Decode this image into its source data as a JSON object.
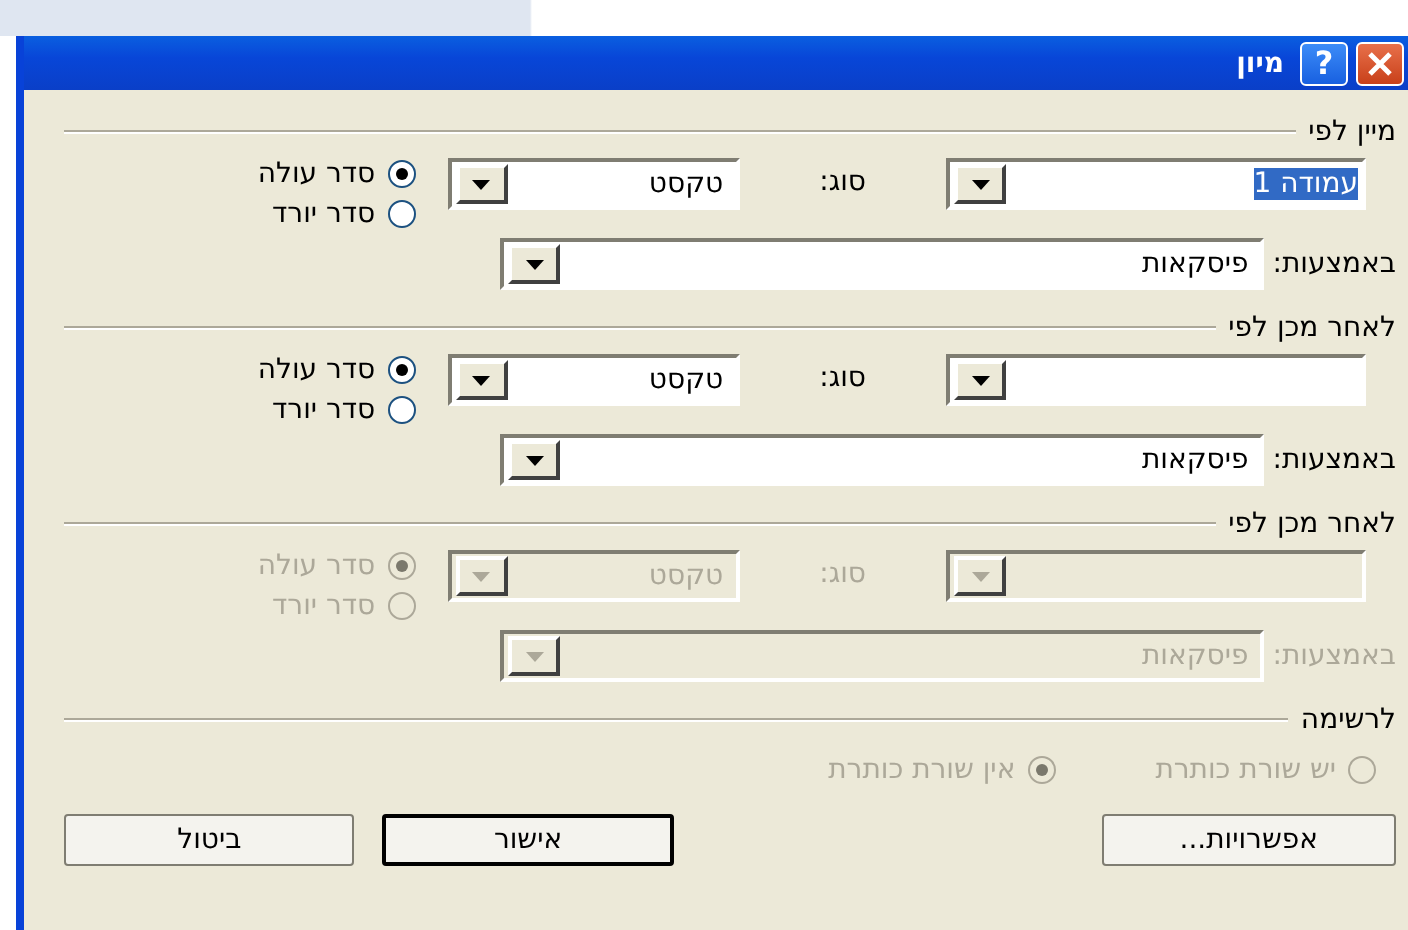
{
  "window": {
    "title": "מיון",
    "help_label": "?"
  },
  "sort_sections": [
    {
      "header": "מיין לפי",
      "disabled": false,
      "field": {
        "value": "עמודה 1",
        "selected": true
      },
      "type_label": "סוג:",
      "type_value": "טקסט",
      "using_label": "באמצעות:",
      "using_value": "פיסקאות",
      "orders": [
        {
          "label": "סדר עולה",
          "selected": true
        },
        {
          "label": "סדר יורד",
          "selected": false
        }
      ]
    },
    {
      "header": "לאחר מכן לפי",
      "disabled": false,
      "type_label": "סוג:",
      "type_value": "טקסט",
      "using_label": "באמצעות:",
      "using_value": "פיסקאות",
      "orders": [
        {
          "label": "סדר עולה",
          "selected": true
        },
        {
          "label": "סדר יורד",
          "selected": false
        }
      ]
    },
    {
      "header": "לאחר מכן לפי",
      "disabled": true,
      "type_label": "סוג:",
      "type_value": "טקסט",
      "using_label": "באמצעות:",
      "using_value": "פיסקאות",
      "orders": [
        {
          "label": "סדר עולה",
          "selected": true
        },
        {
          "label": "סדר יורד",
          "selected": false
        }
      ]
    }
  ],
  "list_section": {
    "header": "לרשימה",
    "disabled": true,
    "options": [
      {
        "label": "יש שורת כותרת",
        "selected": false
      },
      {
        "label": "אין שורת כותרת",
        "selected": true
      }
    ]
  },
  "buttons": [
    {
      "label": "אפשרויות...",
      "default": false
    },
    {
      "label": "אישור",
      "default": true
    },
    {
      "label": "ביטול",
      "default": false
    }
  ]
}
